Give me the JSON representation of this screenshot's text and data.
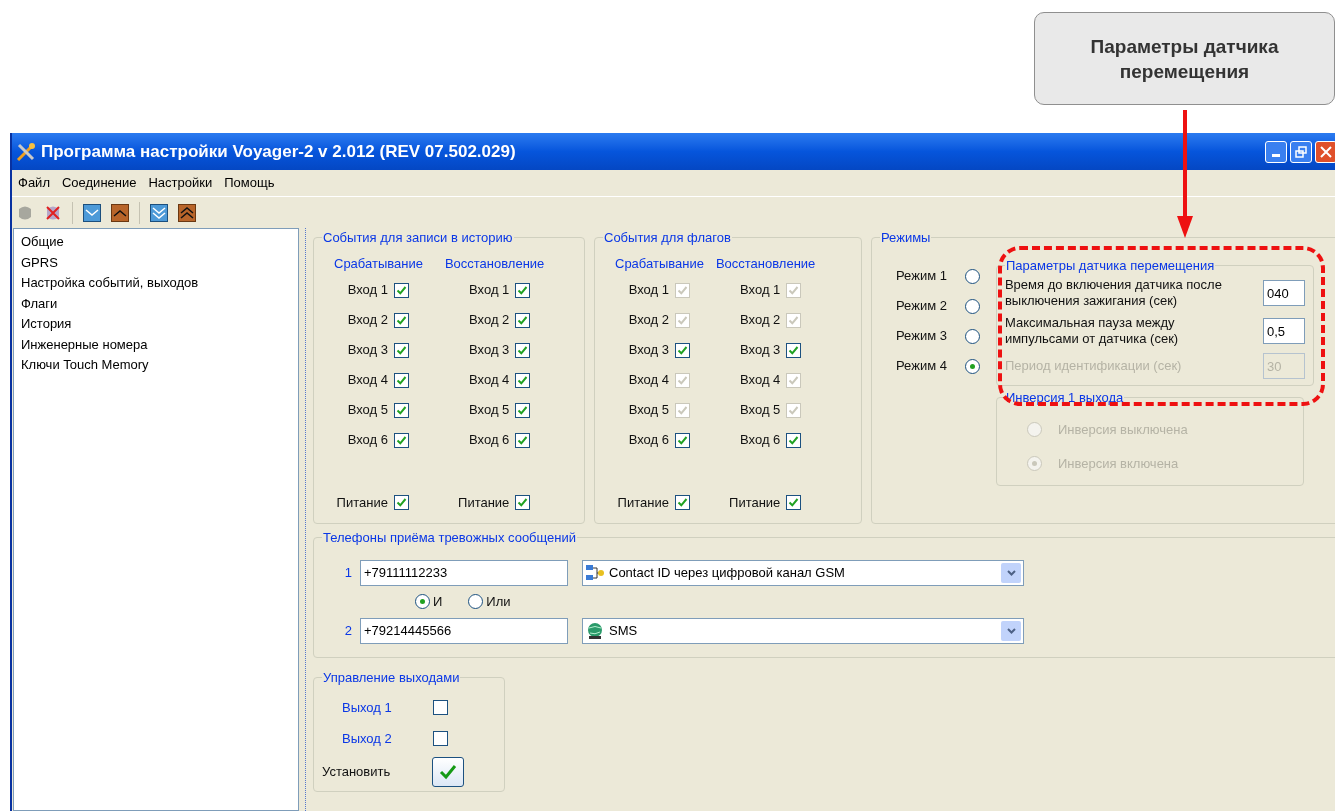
{
  "callout": {
    "text": "Параметры датчика перемещения"
  },
  "window": {
    "title": "Программа настройки Voyager-2 v 2.012 (REV 07.502.029)"
  },
  "menu": [
    "Файл",
    "Соединение",
    "Настройки",
    "Помощь"
  ],
  "sidebar": {
    "items": [
      "Общие",
      "GPRS",
      "Настройка событий, выходов",
      "Флаги",
      "История",
      "Инженерные номера",
      "Ключи Touch Memory"
    ]
  },
  "history_events": {
    "title": "События для записи в историю",
    "columns": [
      {
        "heading": "Срабатывание",
        "items": [
          {
            "label": "Вход 1",
            "checked": true,
            "disabled": false
          },
          {
            "label": "Вход 2",
            "checked": true,
            "disabled": false
          },
          {
            "label": "Вход 3",
            "checked": true,
            "disabled": false
          },
          {
            "label": "Вход 4",
            "checked": true,
            "disabled": false
          },
          {
            "label": "Вход 5",
            "checked": true,
            "disabled": false
          },
          {
            "label": "Вход 6",
            "checked": true,
            "disabled": false
          }
        ],
        "power": {
          "label": "Питание",
          "checked": true,
          "disabled": false
        }
      },
      {
        "heading": "Восстановление",
        "items": [
          {
            "label": "Вход 1",
            "checked": true,
            "disabled": false
          },
          {
            "label": "Вход 2",
            "checked": true,
            "disabled": false
          },
          {
            "label": "Вход 3",
            "checked": true,
            "disabled": false
          },
          {
            "label": "Вход 4",
            "checked": true,
            "disabled": false
          },
          {
            "label": "Вход 5",
            "checked": true,
            "disabled": false
          },
          {
            "label": "Вход 6",
            "checked": true,
            "disabled": false
          }
        ],
        "power": {
          "label": "Питание",
          "checked": true,
          "disabled": false
        }
      }
    ]
  },
  "flag_events": {
    "title": "События для флагов",
    "columns": [
      {
        "heading": "Срабатывание",
        "items": [
          {
            "label": "Вход 1",
            "checked": true,
            "disabled": true
          },
          {
            "label": "Вход 2",
            "checked": true,
            "disabled": true
          },
          {
            "label": "Вход 3",
            "checked": true,
            "disabled": false
          },
          {
            "label": "Вход 4",
            "checked": true,
            "disabled": true
          },
          {
            "label": "Вход 5",
            "checked": true,
            "disabled": true
          },
          {
            "label": "Вход 6",
            "checked": true,
            "disabled": false
          }
        ],
        "power": {
          "label": "Питание",
          "checked": true,
          "disabled": false
        }
      },
      {
        "heading": "Восстановление",
        "items": [
          {
            "label": "Вход 1",
            "checked": true,
            "disabled": true
          },
          {
            "label": "Вход 2",
            "checked": true,
            "disabled": true
          },
          {
            "label": "Вход 3",
            "checked": true,
            "disabled": false
          },
          {
            "label": "Вход 4",
            "checked": true,
            "disabled": true
          },
          {
            "label": "Вход 5",
            "checked": true,
            "disabled": true
          },
          {
            "label": "Вход 6",
            "checked": true,
            "disabled": false
          }
        ],
        "power": {
          "label": "Питание",
          "checked": true,
          "disabled": false
        }
      }
    ]
  },
  "modes": {
    "title": "Режимы",
    "items": [
      {
        "label": "Режим 1",
        "selected": false
      },
      {
        "label": "Режим 2",
        "selected": false
      },
      {
        "label": "Режим 3",
        "selected": false
      },
      {
        "label": "Режим 4",
        "selected": true
      }
    ]
  },
  "motion_sensor": {
    "title": "Параметры датчика перемещения",
    "fields": [
      {
        "label": "Время до включения датчика после выключения зажигания (сек)",
        "value": "040",
        "disabled": false
      },
      {
        "label": "Максимальная пауза между импульсами от датчика (сек)",
        "value": "0,5",
        "disabled": false
      },
      {
        "label": "Период идентификации (сек)",
        "value": "30",
        "disabled": true
      }
    ]
  },
  "inversion": {
    "title": "Инверсия 1 выхода",
    "disabled": true,
    "options": [
      {
        "label": "Инверсия выключена",
        "selected": false
      },
      {
        "label": "Инверсия включена",
        "selected": true
      }
    ]
  },
  "phones": {
    "title": "Телефоны приёма тревожных сообщений",
    "rows": [
      {
        "index": "1",
        "number": "+79111112233",
        "channel": "Contact ID через цифровой канал GSM",
        "kind": "network"
      },
      {
        "index": "2",
        "number": "+79214445566",
        "channel": "SMS",
        "kind": "globe"
      }
    ],
    "logic": [
      {
        "label": "И",
        "selected": true
      },
      {
        "label": "Или",
        "selected": false
      }
    ]
  },
  "outputs": {
    "title": "Управление выходами",
    "items": [
      {
        "label": "Выход 1",
        "checked": false
      },
      {
        "label": "Выход 2",
        "checked": false
      }
    ],
    "apply": {
      "label": "Установить"
    }
  }
}
